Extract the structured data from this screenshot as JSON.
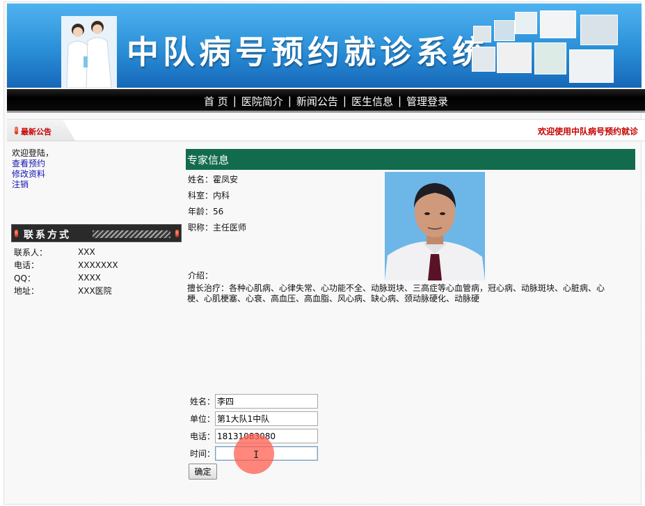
{
  "banner": {
    "title": "中队病号预约就诊系统"
  },
  "nav": {
    "items": [
      {
        "label": "首 页"
      },
      {
        "label": "医院简介"
      },
      {
        "label": "新闻公告"
      },
      {
        "label": "医生信息"
      },
      {
        "label": "管理登录"
      }
    ],
    "separator": "|"
  },
  "notice": {
    "tab_label": "最新公告",
    "scroll_text": "欢迎使用中队病号预约就诊"
  },
  "sidebar": {
    "welcome": "欢迎登陆，",
    "links": [
      {
        "label": "查看预约"
      },
      {
        "label": "修改资料"
      },
      {
        "label": "注销"
      }
    ],
    "contact_title": "联系方式",
    "contact": [
      {
        "key": "联系人：",
        "value": "XXX"
      },
      {
        "key": "电话：",
        "value": "XXXXXXX"
      },
      {
        "key": "QQ：",
        "value": "XXXX"
      },
      {
        "key": "地址：",
        "value": "XXX医院"
      }
    ]
  },
  "expert": {
    "heading": "专家信息",
    "name_line": "姓名：霍凤安",
    "dept_line": "科室：内科",
    "age_line": "年龄：56",
    "title_line": "职称：主任医师",
    "intro_label": "介绍：",
    "description": "擅长治疗：各种心肌病、心律失常、心功能不全、动脉斑块、三高症等心血管病，冠心病、动脉斑块、心脏病、心梗、心肌梗塞、心衰、高血压、高血脂、风心病、缺心病、颈动脉硬化、动脉硬"
  },
  "form": {
    "name_label": "姓名：",
    "name_value": "李四",
    "unit_label": "单位：",
    "unit_value": "第1大队1中队",
    "phone_label": "电话：",
    "phone_value": "18131083080",
    "time_label": "时间：",
    "time_value": "",
    "submit_label": "确定"
  },
  "icons": {
    "notice": "red-pill-icon",
    "contact": "red-pill-icon",
    "cursor": "text-cursor-icon"
  },
  "colors": {
    "nav_bg": "#000000",
    "header_green": "#136b4d",
    "notice_red": "#c40000",
    "link_blue": "#1414b4",
    "banner_blue": "#2b8fd8"
  }
}
